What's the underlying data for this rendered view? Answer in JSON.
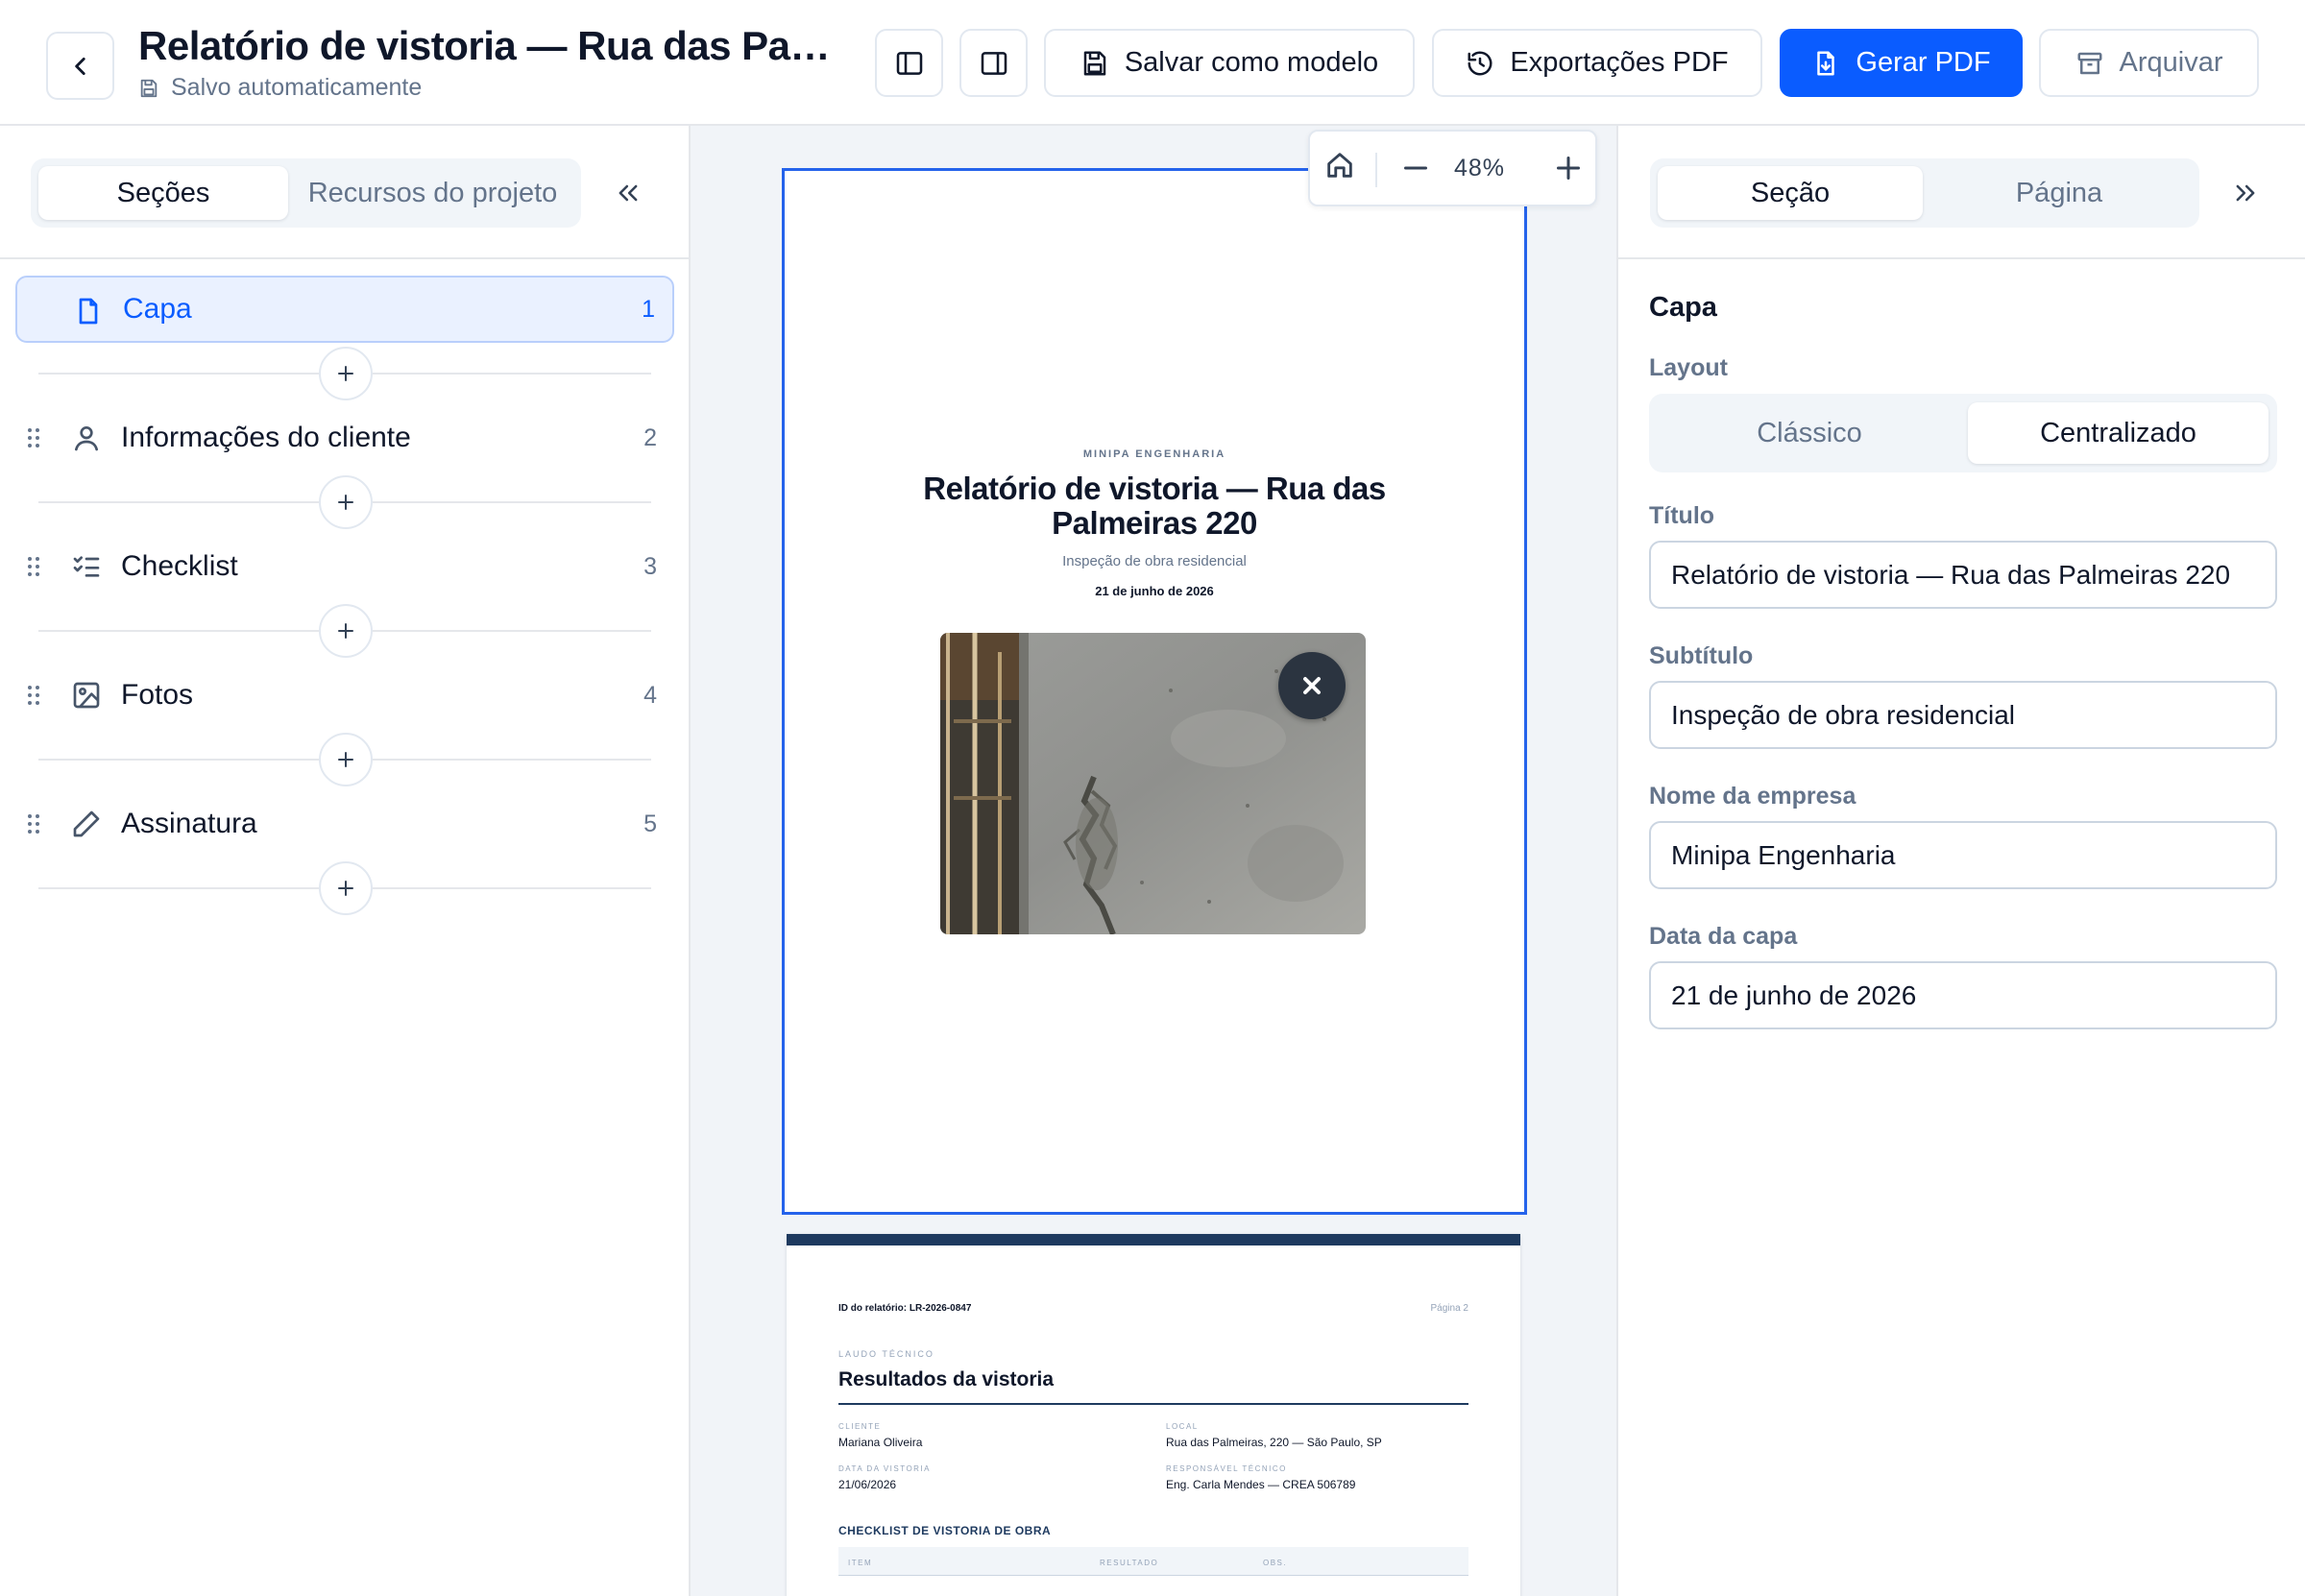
{
  "header": {
    "title": "Relatório de vistoria — Rua das Palm…",
    "save_status": "Salvo automaticamente",
    "buttons": {
      "save_template": "Salvar como modelo",
      "pdf_exports": "Exportações PDF",
      "generate_pdf": "Gerar PDF",
      "archive": "Arquivar"
    }
  },
  "left_panel": {
    "tabs": [
      "Seções",
      "Recursos do projeto"
    ],
    "active_tab": "Seções",
    "sections": [
      {
        "label": "Capa",
        "number": "1",
        "icon": "file-icon",
        "active": true
      },
      {
        "label": "Informações do cliente",
        "number": "2",
        "icon": "user-icon",
        "active": false
      },
      {
        "label": "Checklist",
        "number": "3",
        "icon": "checklist-icon",
        "active": false
      },
      {
        "label": "Fotos",
        "number": "4",
        "icon": "image-icon",
        "active": false
      },
      {
        "label": "Assinatura",
        "number": "5",
        "icon": "pen-icon",
        "active": false
      }
    ]
  },
  "canvas": {
    "zoom": "48%",
    "page1": {
      "company": "MINIPA ENGENHARIA",
      "title": "Relatório de vistoria — Rua das Palmeiras 220",
      "subtitle": "Inspeção de obra residencial",
      "date": "21 de junho de 2026"
    },
    "page2": {
      "report_id": "ID do relatório: LR-2026-0847",
      "page_label": "Página 2",
      "kicker": "LAUDO TÉCNICO",
      "heading": "Resultados da vistoria",
      "client_label": "CLIENTE",
      "client": "Mariana Oliveira",
      "location_label": "LOCAL",
      "location": "Rua das Palmeiras, 220 — São Paulo, SP",
      "date_label": "DATA DA VISTORIA",
      "date": "21/06/2026",
      "engineer_label": "RESPONSÁVEL TÉCNICO",
      "engineer": "Eng. Carla Mendes — CREA 506789",
      "checklist_title": "CHECKLIST DE VISTORIA DE OBRA",
      "columns": [
        "ITEM",
        "RESULTADO",
        "OBS."
      ]
    }
  },
  "right_panel": {
    "tabs": [
      "Seção",
      "Página"
    ],
    "active_tab": "Seção",
    "section_title": "Capa",
    "layout_label": "Layout",
    "layout_options": [
      "Clássico",
      "Centralizado"
    ],
    "layout_selected": "Centralizado",
    "fields": [
      {
        "label": "Título",
        "value": "Relatório de vistoria — Rua das Palmeiras 220"
      },
      {
        "label": "Subtítulo",
        "value": "Inspeção de obra residencial"
      },
      {
        "label": "Nome da empresa",
        "value": "Minipa Engenharia"
      },
      {
        "label": "Data da capa",
        "value": "21 de junho de 2026"
      }
    ]
  },
  "colors": {
    "primary": "#0a5cff",
    "active_bg": "#eaf1ff",
    "text": "#0f172a",
    "muted": "#64748b",
    "border": "#e2e8f0",
    "report_navy": "#1e3a5f"
  }
}
